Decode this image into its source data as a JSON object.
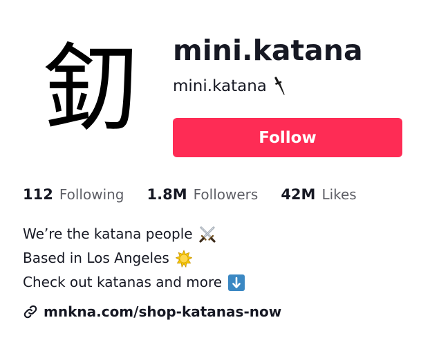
{
  "profile": {
    "avatar_glyph": "釖",
    "username": "mini.katana",
    "nickname": "mini.katana",
    "nickname_emoji_icon": "dagger-icon",
    "follow_label": "Follow"
  },
  "stats": [
    {
      "value": "112",
      "label": "Following"
    },
    {
      "value": "1.8M",
      "label": "Followers"
    },
    {
      "value": "42M",
      "label": "Likes"
    }
  ],
  "bio": [
    {
      "text": "We’re the katana people",
      "emoji_icon": "crossed-swords-icon"
    },
    {
      "text": "Based in Los Angeles",
      "emoji_icon": "sun-icon"
    },
    {
      "text": "Check out katanas and more",
      "emoji_icon": "down-arrow-icon"
    }
  ],
  "link": {
    "icon": "link-icon",
    "text": "mnkna.com/shop-katanas-now"
  },
  "colors": {
    "accent": "#fe2c55",
    "text_primary": "#161823",
    "text_secondary": "#5e5f66"
  }
}
